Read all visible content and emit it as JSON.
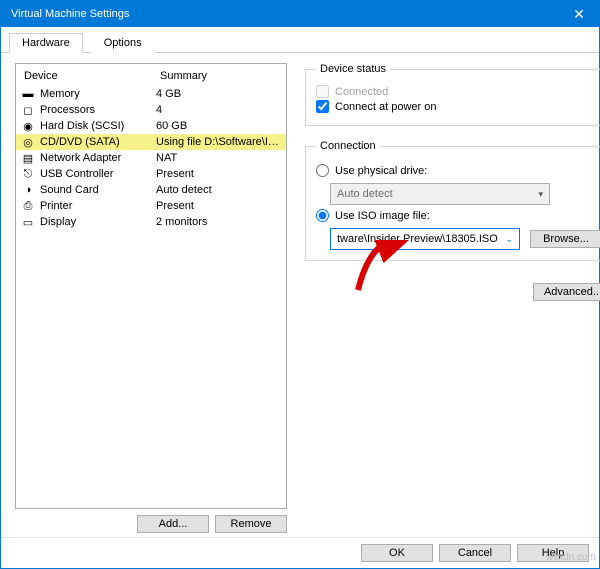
{
  "window": {
    "title": "Virtual Machine Settings"
  },
  "tabs": {
    "hardware": "Hardware",
    "options": "Options"
  },
  "columns": {
    "device": "Device",
    "summary": "Summary"
  },
  "devices": [
    {
      "name": "Memory",
      "icon": "memory-icon",
      "summary": "4 GB"
    },
    {
      "name": "Processors",
      "icon": "cpu-icon",
      "summary": "4"
    },
    {
      "name": "Hard Disk (SCSI)",
      "icon": "disk-icon",
      "summary": "60 GB"
    },
    {
      "name": "CD/DVD (SATA)",
      "icon": "cd-icon",
      "summary": "Using file D:\\Software\\Insider ...",
      "selected": true
    },
    {
      "name": "Network Adapter",
      "icon": "network-icon",
      "summary": "NAT"
    },
    {
      "name": "USB Controller",
      "icon": "usb-icon",
      "summary": "Present"
    },
    {
      "name": "Sound Card",
      "icon": "sound-icon",
      "summary": "Auto detect"
    },
    {
      "name": "Printer",
      "icon": "printer-icon",
      "summary": "Present"
    },
    {
      "name": "Display",
      "icon": "display-icon",
      "summary": "2 monitors"
    }
  ],
  "buttons": {
    "add": "Add...",
    "remove": "Remove",
    "browse": "Browse...",
    "advanced": "Advanced...",
    "ok": "OK",
    "cancel": "Cancel",
    "help": "Help"
  },
  "status": {
    "legend": "Device status",
    "connected": "Connected",
    "connect_at_power_on": "Connect at power on"
  },
  "connection": {
    "legend": "Connection",
    "use_physical": "Use physical drive:",
    "physical_value": "Auto detect",
    "use_iso": "Use ISO image file:",
    "iso_value": "tware\\Insider Preview\\18305.ISO"
  },
  "watermark": "wsxdn.com"
}
